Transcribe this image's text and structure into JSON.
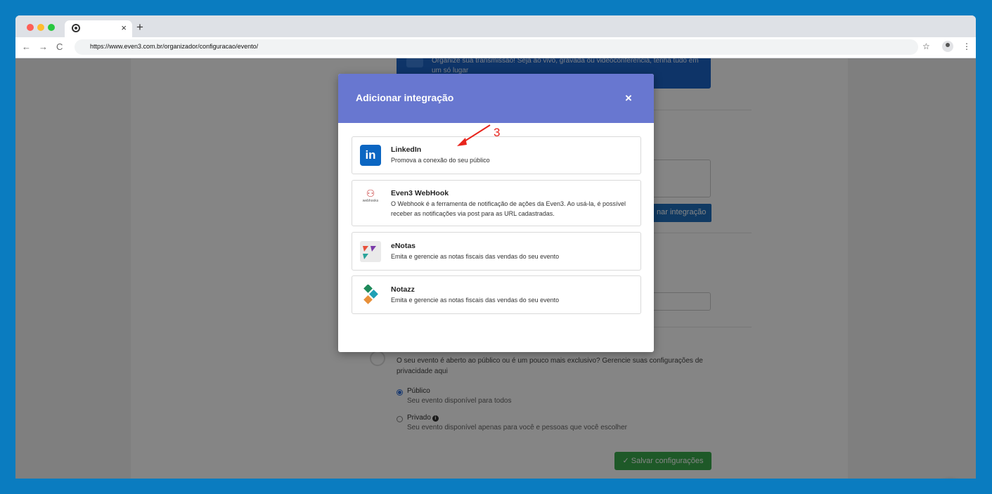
{
  "browser": {
    "tab_close": "×",
    "new_tab": "+",
    "url": "https://www.even3.com.br/organizador/configuracao/evento/",
    "back_icon": "←",
    "forward_icon": "→",
    "reload_icon": "C",
    "star_icon": "☆",
    "menu_icon": "⋮"
  },
  "page": {
    "banner_text": "Organize sua transmissão! Seja ao vivo, gravada ou videoconferência, tenha tudo em um só lugar",
    "add_integration_button": "nar integração",
    "privacy_description": "O seu evento é aberto ao público ou é um pouco mais exclusivo? Gerencie suas configurações de privacidade aqui",
    "options": [
      {
        "title": "Público",
        "description": "Seu evento disponível para todos",
        "selected": true
      },
      {
        "title": "Privado",
        "description": "Seu evento disponível apenas para você e pessoas que você escolher",
        "selected": false
      }
    ],
    "save_button": "✓ Salvar configurações"
  },
  "modal": {
    "title": "Adicionar integração",
    "close": "×",
    "integrations": [
      {
        "name": "LinkedIn",
        "description": "Promova a conexão do seu público",
        "icon": "linkedin-icon",
        "logo_text": "in"
      },
      {
        "name": "Even3 WebHook",
        "description": "O Webhook é a ferramenta de notificação de ações da Even3. Ao usá-la, é possível receber as notificações via post para as URL cadastradas.",
        "icon": "webhook-icon",
        "logo_text": "webhooks"
      },
      {
        "name": "eNotas",
        "description": "Emita e gerencie as notas fiscais das vendas do seu evento",
        "icon": "enotas-icon"
      },
      {
        "name": "Notazz",
        "description": "Emita e gerencie as notas fiscais das vendas do seu evento",
        "icon": "notazz-icon"
      }
    ]
  },
  "annotation": {
    "label": "3",
    "color": "#e8241c"
  },
  "colors": {
    "modal_header": "#6877d0",
    "linkedin": "#0b66c2",
    "save": "#3bab4e"
  }
}
